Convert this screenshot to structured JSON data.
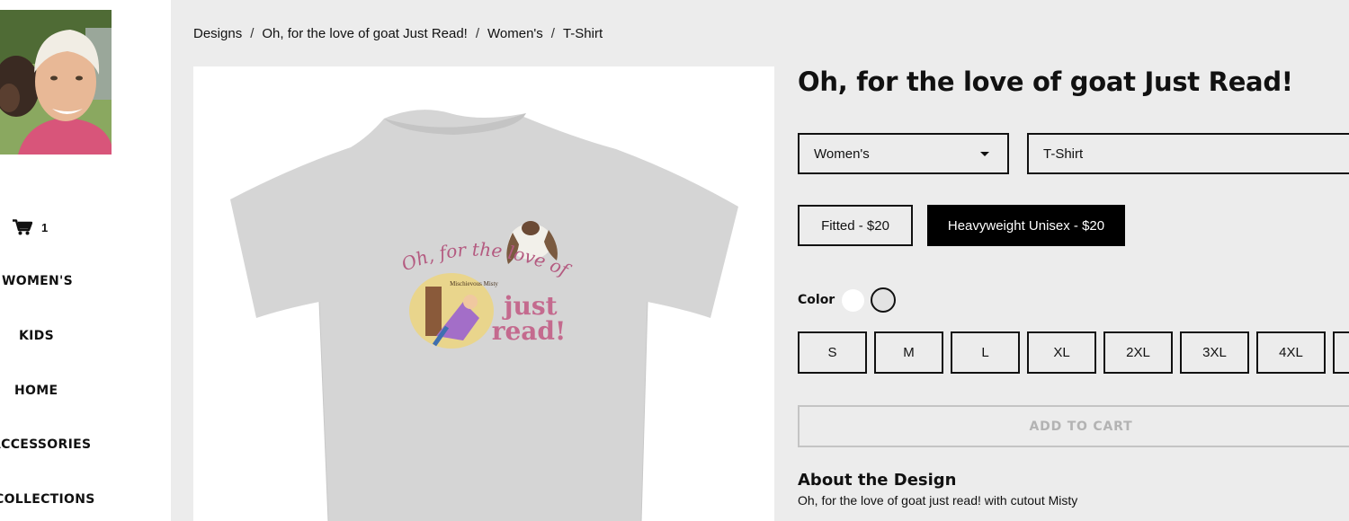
{
  "sidebar": {
    "cart_count": "1",
    "nav": {
      "womens": "WOMEN'S",
      "kids": "KIDS",
      "home": "HOME",
      "accessories": "ACCESSORIES",
      "collections": "COLLECTIONS"
    }
  },
  "breadcrumb": {
    "items": [
      "Designs",
      "Oh, for the love of goat Just Read!",
      "Women's",
      "T-Shirt"
    ],
    "separator": "/"
  },
  "product": {
    "title": "Oh, for the love of goat Just Read!",
    "gender_select": "Women's",
    "product_select": "T-Shirt",
    "styles": [
      "Fitted - $20",
      "Heavyweight Unisex - $20"
    ],
    "selected_style": "Heavyweight Unisex - $20",
    "color_label": "Color",
    "colors": {
      "white": "#ffffff",
      "heather_gray": "#e3e3e3"
    },
    "selected_color": "heather_gray",
    "sizes": [
      "S",
      "M",
      "L",
      "XL",
      "2XL",
      "3XL",
      "4XL"
    ],
    "add_to_cart": "ADD TO CART"
  },
  "shirt_graphic": {
    "arc_text": "Oh, for the love of goat",
    "line1": "just",
    "line2": "read!",
    "book_title": "Mischievous Misty"
  },
  "about": {
    "title": "About the Design",
    "text": "Oh, for the love of goat just read! with cutout Misty"
  }
}
